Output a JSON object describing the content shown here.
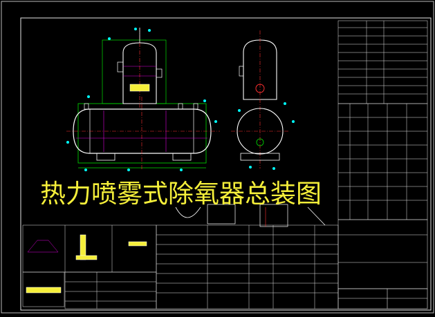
{
  "drawing": {
    "title": "热力喷雾式除氧器总装图"
  },
  "colors": {
    "background": "#000000",
    "frame": "#e6e6e6",
    "vessel_outline": "#ffffff",
    "construction": "#e000e0",
    "dimension": "#00e000",
    "centerline": "#ff3030",
    "callout": "#00ffff",
    "table_line": "#e6e6e6",
    "table_text": "#4a88ff",
    "title_text": "#f5ef3a"
  }
}
